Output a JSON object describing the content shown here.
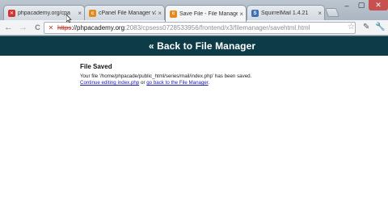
{
  "browser": {
    "tabs": [
      {
        "title": "phpacademy.org/cpa",
        "favicon_color": "#d0352f",
        "favicon_glyph": "✕",
        "active": false
      },
      {
        "title": "cPanel File Manager v3",
        "favicon_color": "#e58b1c",
        "favicon_glyph": "c",
        "active": false
      },
      {
        "title": "Save File - File Manager",
        "favicon_color": "#e58b1c",
        "favicon_glyph": "c",
        "active": true
      },
      {
        "title": "SquirrelMail 1.4.21",
        "favicon_color": "#3b6fb6",
        "favicon_glyph": "S",
        "active": false
      }
    ],
    "tab_close_glyph": "×",
    "new_tab_icon": "new-tab-icon",
    "window_buttons": {
      "minimize": "–",
      "maximize": "▢",
      "close": "✕"
    },
    "nav": {
      "back": "←",
      "forward": "→",
      "reload": "C"
    },
    "address": {
      "scheme": "https",
      "host": "://phpacademy.org",
      "path": ":2083/cpsess0728533956/frontend/x3/filemanager/savehtml.html"
    },
    "star_icon": "☆",
    "tools": [
      "✎",
      "🔧"
    ]
  },
  "page": {
    "header_link": "« Back to File Manager",
    "heading": "File Saved",
    "message": "Your file '/home/phpacade/public_html/series/mail/index.php' has been saved.",
    "continue_link": "Continue editing index.php",
    "or_text": " or ",
    "back_link": "go back to the File Manager",
    "period": "."
  },
  "colors": {
    "header_bg": "#0d3b47",
    "link": "#1a1aa6"
  }
}
